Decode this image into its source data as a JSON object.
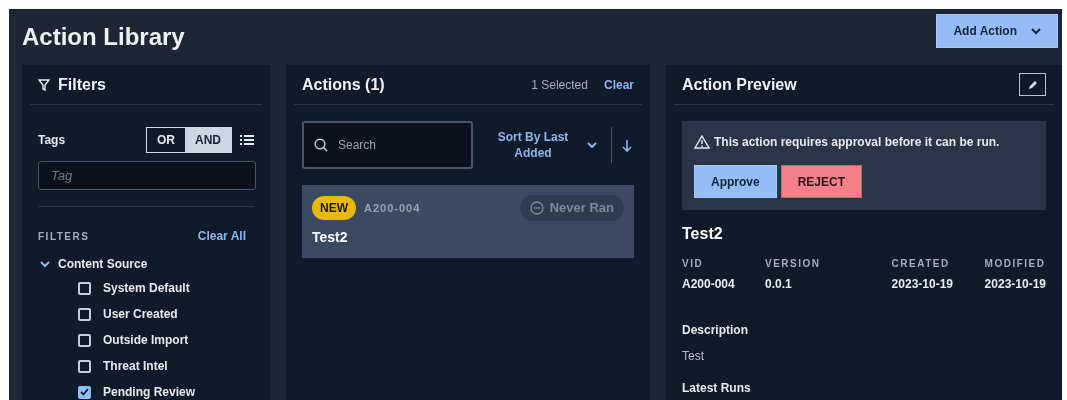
{
  "page": {
    "title": "Action Library",
    "add_button": "Add Action"
  },
  "filters": {
    "title": "Filters",
    "tags_label": "Tags",
    "logic": [
      {
        "label": "OR",
        "selected": false
      },
      {
        "label": "AND",
        "selected": true
      }
    ],
    "tag_placeholder": "Tag",
    "section_label": "FILTERS",
    "clear_all": "Clear All",
    "groups": [
      {
        "label": "Content Source",
        "expanded": true,
        "options": [
          {
            "label": "System Default",
            "checked": false
          },
          {
            "label": "User Created",
            "checked": false
          },
          {
            "label": "Outside Import",
            "checked": false
          },
          {
            "label": "Threat Intel",
            "checked": false
          },
          {
            "label": "Pending Review",
            "checked": true
          }
        ]
      }
    ]
  },
  "actions": {
    "title": "Actions (1)",
    "selected_count": "1 Selected",
    "clear": "Clear",
    "search_placeholder": "Search",
    "sort_label": "Sort By Last Added",
    "items": [
      {
        "badge": "NEW",
        "vid": "A200-004",
        "status": "Never Ran",
        "name": "Test2",
        "selected": true
      }
    ]
  },
  "preview": {
    "title": "Action Preview",
    "warning": "This action requires approval before it can be run.",
    "approve": "Approve",
    "reject": "REJECT",
    "name": "Test2",
    "fields": [
      {
        "label": "VID",
        "value": "A200-004"
      },
      {
        "label": "VERSION",
        "value": "0.0.1"
      },
      {
        "label": "CREATED",
        "value": "2023-10-19"
      },
      {
        "label": "MODIFIED",
        "value": "2023-10-19"
      }
    ],
    "description_label": "Description",
    "description": "Test",
    "latest_runs_label": "Latest Runs"
  }
}
